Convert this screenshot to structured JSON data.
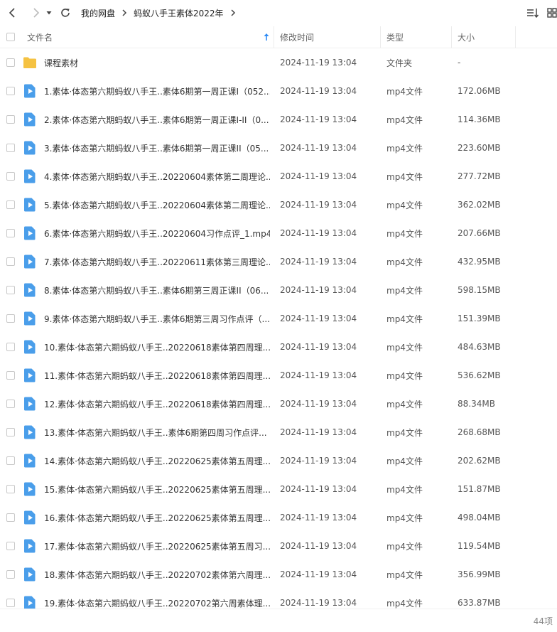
{
  "toolbar": {
    "back_icon": "chevron-left-icon",
    "forward_icon": "chevron-right-icon",
    "history_icon": "caret-down-icon",
    "refresh_icon": "refresh-icon",
    "breadcrumb": [
      "我的网盘",
      "蚂蚁八手王素体2022年"
    ],
    "sort_icon": "sort-list-icon",
    "view_icon": "grid-view-icon"
  },
  "header": {
    "name": "文件名",
    "modified": "修改时间",
    "type": "类型",
    "size": "大小",
    "sort_icon": "arrow-up-icon"
  },
  "colors": {
    "folder": "#F5C242",
    "video": "#4A9EEA",
    "accent": "#2F8BF5"
  },
  "rows": [
    {
      "icon": "folder-icon",
      "name": "课程素材",
      "time": "2024-11-19 13:04",
      "type": "文件夹",
      "size": "-"
    },
    {
      "icon": "video-file-icon",
      "name": "1.素体·体态第六期蚂蚁八手王..素体6期第一周正课I（052...",
      "time": "2024-11-19 13:04",
      "type": "mp4文件",
      "size": "172.06MB"
    },
    {
      "icon": "video-file-icon",
      "name": "2.素体·体态第六期蚂蚁八手王..素体6期第一周正课I-II（0...",
      "time": "2024-11-19 13:04",
      "type": "mp4文件",
      "size": "114.36MB"
    },
    {
      "icon": "video-file-icon",
      "name": "3.素体·体态第六期蚂蚁八手王..素体6期第一周正课II（05...",
      "time": "2024-11-19 13:04",
      "type": "mp4文件",
      "size": "223.60MB"
    },
    {
      "icon": "video-file-icon",
      "name": "4.素体·体态第六期蚂蚁八手王..20220604素体第二周理论...",
      "time": "2024-11-19 13:04",
      "type": "mp4文件",
      "size": "277.72MB"
    },
    {
      "icon": "video-file-icon",
      "name": "5.素体·体态第六期蚂蚁八手王..20220604素体第二周理论...",
      "time": "2024-11-19 13:04",
      "type": "mp4文件",
      "size": "362.02MB"
    },
    {
      "icon": "video-file-icon",
      "name": "6.素体·体态第六期蚂蚁八手王..20220604习作点评_1.mp4",
      "time": "2024-11-19 13:04",
      "type": "mp4文件",
      "size": "207.66MB"
    },
    {
      "icon": "video-file-icon",
      "name": "7.素体·体态第六期蚂蚁八手王..20220611素体第三周理论...",
      "time": "2024-11-19 13:04",
      "type": "mp4文件",
      "size": "432.95MB"
    },
    {
      "icon": "video-file-icon",
      "name": "8.素体·体态第六期蚂蚁八手王..素体6期第三周正课II（06...",
      "time": "2024-11-19 13:04",
      "type": "mp4文件",
      "size": "598.15MB"
    },
    {
      "icon": "video-file-icon",
      "name": "9.素体·体态第六期蚂蚁八手王..素体6期第三周习作点评（...",
      "time": "2024-11-19 13:04",
      "type": "mp4文件",
      "size": "151.39MB"
    },
    {
      "icon": "video-file-icon",
      "name": "10.素体·体态第六期蚂蚁八手王..20220618素体第四周理...",
      "time": "2024-11-19 13:04",
      "type": "mp4文件",
      "size": "484.63MB"
    },
    {
      "icon": "video-file-icon",
      "name": "11.素体·体态第六期蚂蚁八手王..20220618素体第四周理...",
      "time": "2024-11-19 13:04",
      "type": "mp4文件",
      "size": "536.62MB"
    },
    {
      "icon": "video-file-icon",
      "name": "12.素体·体态第六期蚂蚁八手王..20220618素体第四周理...",
      "time": "2024-11-19 13:04",
      "type": "mp4文件",
      "size": "88.34MB"
    },
    {
      "icon": "video-file-icon",
      "name": "13.素体·体态第六期蚂蚁八手王..素体6期第四周习作点评...",
      "time": "2024-11-19 13:04",
      "type": "mp4文件",
      "size": "268.68MB"
    },
    {
      "icon": "video-file-icon",
      "name": "14.素体·体态第六期蚂蚁八手王..20220625素体第五周理...",
      "time": "2024-11-19 13:04",
      "type": "mp4文件",
      "size": "202.62MB"
    },
    {
      "icon": "video-file-icon",
      "name": "15.素体·体态第六期蚂蚁八手王..20220625素体第五周理...",
      "time": "2024-11-19 13:04",
      "type": "mp4文件",
      "size": "151.87MB"
    },
    {
      "icon": "video-file-icon",
      "name": "16.素体·体态第六期蚂蚁八手王..20220625素体第五周理...",
      "time": "2024-11-19 13:04",
      "type": "mp4文件",
      "size": "498.04MB"
    },
    {
      "icon": "video-file-icon",
      "name": "17.素体·体态第六期蚂蚁八手王..20220625素体第五周习...",
      "time": "2024-11-19 13:04",
      "type": "mp4文件",
      "size": "119.54MB"
    },
    {
      "icon": "video-file-icon",
      "name": "18.素体·体态第六期蚂蚁八手王..20220702素体第六周理...",
      "time": "2024-11-19 13:04",
      "type": "mp4文件",
      "size": "356.99MB"
    },
    {
      "icon": "video-file-icon",
      "name": "19.素体·体态第六期蚂蚁八手王..20220702第六周素体理...",
      "time": "2024-11-19 13:04",
      "type": "mp4文件",
      "size": "633.87MB"
    }
  ],
  "footer": {
    "count": "44项"
  }
}
